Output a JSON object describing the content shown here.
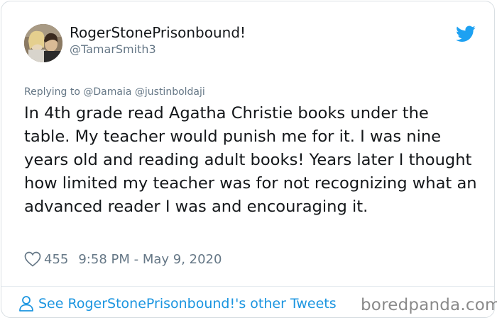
{
  "author": {
    "name": "RogerStonePrisonbound!",
    "handle": "@TamarSmith3"
  },
  "reply": {
    "prefix": "Replying to",
    "mentions": "@Damaia @justinboldaji"
  },
  "tweet": {
    "text": "In 4th grade read Agatha Christie books under the table. My teacher would punish me for it. I was nine years old and reading adult books! Years later I thought how limited my teacher was for not recognizing what an advanced reader I was and encouraging it.",
    "likes": "455",
    "timestamp": "9:58 PM - May 9, 2020"
  },
  "footer": {
    "see_more": "See RogerStonePrisonbound!'s other Tweets",
    "watermark": "boredpanda.com"
  },
  "icons": {
    "brand": "twitter-bird-icon",
    "like": "heart-icon",
    "profile": "person-icon"
  },
  "colors": {
    "brand_blue": "#1da1f2",
    "link_blue": "#1b95e0",
    "text": "#14171a",
    "muted": "#657786"
  }
}
